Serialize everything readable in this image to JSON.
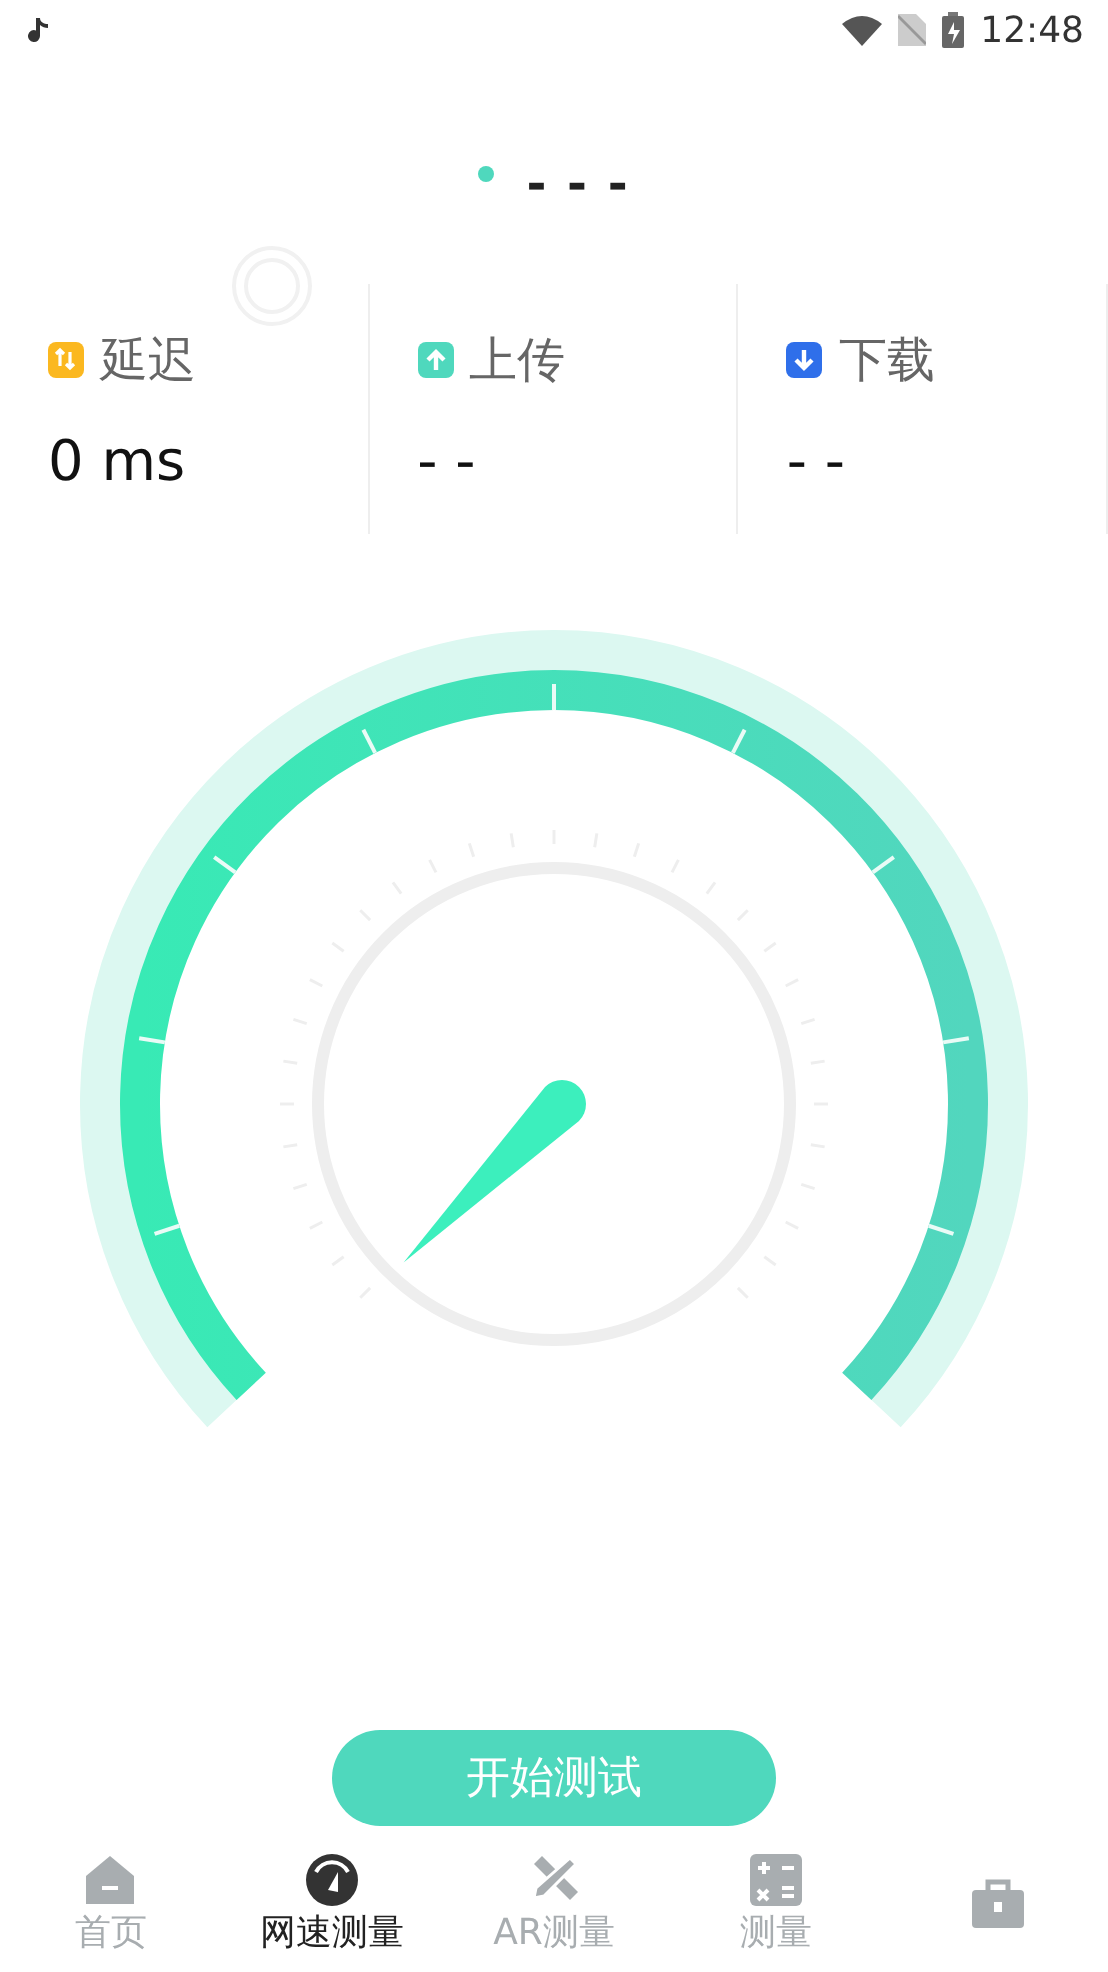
{
  "status_bar": {
    "time": "12:48"
  },
  "server": {
    "name": "- - -"
  },
  "stats": [
    {
      "kind": "latency",
      "label": "延迟",
      "value": "0 ms",
      "color": "#fbb820"
    },
    {
      "kind": "upload",
      "label": "上传",
      "value": "- -",
      "color": "#4fd8bd"
    },
    {
      "kind": "download",
      "label": "下载",
      "value": "- -",
      "color": "#2f6fea"
    }
  ],
  "start_button": "开始测试",
  "tabs": [
    {
      "kind": "home",
      "label": "首页",
      "selected": false
    },
    {
      "kind": "speed",
      "label": "网速测量",
      "selected": true
    },
    {
      "kind": "ar",
      "label": "AR测量",
      "selected": false
    },
    {
      "kind": "measure",
      "label": "测量",
      "selected": false
    },
    {
      "kind": "tools",
      "selected": false
    }
  ]
}
